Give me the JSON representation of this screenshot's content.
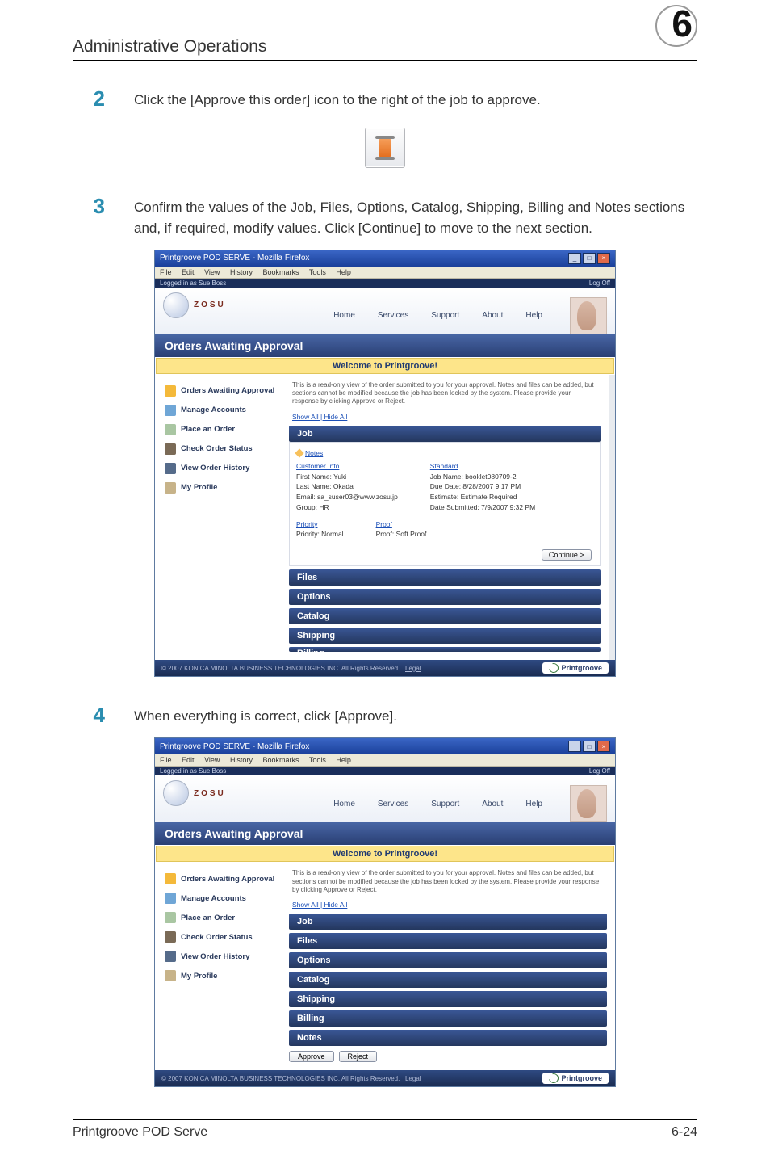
{
  "page": {
    "header_title": "Administrative Operations",
    "chapter": "6",
    "footer_left": "Printgroove POD Serve",
    "footer_right": "6-24"
  },
  "steps": {
    "s2": {
      "num": "2",
      "text": "Click the [Approve this order] icon to the right of the job to approve."
    },
    "s3": {
      "num": "3",
      "text": "Confirm the values of the Job, Files, Options, Catalog, Shipping, Billing and Notes sections and, if required, modify values. Click [Continue] to move to the next section."
    },
    "s4": {
      "num": "4",
      "text": "When everything is correct, click [Approve]."
    }
  },
  "browser": {
    "title": "Printgroove POD SERVE - Mozilla Firefox",
    "menus": {
      "file": "File",
      "edit": "Edit",
      "view": "View",
      "history": "History",
      "bookmarks": "Bookmarks",
      "tools": "Tools",
      "help": "Help"
    },
    "login_strip": "Logged in as Sue Boss",
    "logoff": "Log Off"
  },
  "topnav": {
    "home": "Home",
    "services": "Services",
    "support": "Support",
    "about": "About",
    "help": "Help"
  },
  "logo_text": "ZOSU",
  "bluebar": "Orders Awaiting Approval",
  "welcome": "Welcome to Printgroove!",
  "sidenav": {
    "i0": "Orders Awaiting Approval",
    "i1": "Manage Accounts",
    "i2": "Place an Order",
    "i3": "Check Order Status",
    "i4": "View Order History",
    "i5": "My Profile"
  },
  "readonly_note": "This is a read-only view of the order submitted to you for your approval. Notes and files can be added, but sections cannot be modified because the job has been locked by the system. Please provide your response by clicking Approve or Reject.",
  "showhide": "Show All | Hide All",
  "panels": {
    "job": "Job",
    "files": "Files",
    "options": "Options",
    "catalog": "Catalog",
    "shipping": "Shipping",
    "billing": "Billing",
    "notes": "Notes"
  },
  "job": {
    "notes_link": "Notes",
    "customer_link": "Customer Info",
    "standard_link": "Standard",
    "priority_link": "Priority",
    "proof_link": "Proof",
    "left": {
      "first": "First Name: Yuki",
      "last": "Last Name: Okada",
      "email": "Email: sa_suser03@www.zosu.jp",
      "group": "Group: HR"
    },
    "right": {
      "jobname": "Job Name: booklet080709-2",
      "due": "Due Date: 8/28/2007 9:17 PM",
      "estimate": "Estimate: Estimate Required",
      "submitted": "Date Submitted: 7/9/2007 9:32 PM"
    },
    "priority_val": "Priority: Normal",
    "proof_val": "Proof: Soft Proof"
  },
  "buttons": {
    "continue": "Continue >",
    "approve": "Approve",
    "reject": "Reject"
  },
  "footer_legal": "© 2007 KONICA MINOLTA BUSINESS TECHNOLOGIES INC. All Rights Reserved.",
  "footer_legal_link": "Legal",
  "pg_logo": "Printgroove"
}
